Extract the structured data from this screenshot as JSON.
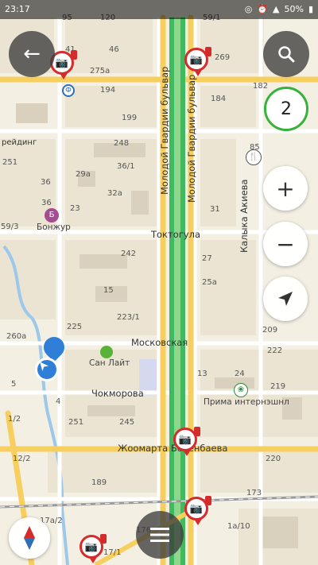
{
  "status_bar": {
    "time": "23:17",
    "battery": "50%",
    "icons": [
      "whatsapp-icon",
      "alarm-icon",
      "signal-icon",
      "battery-icon"
    ]
  },
  "map": {
    "streets": {
      "toktogula": "Токтогула",
      "moskovskaya": "Московская",
      "chokmorova": "Чокморова",
      "zhoomarta": "Жоомарта Бокенбаева",
      "molodoy_gvardii_1": "Молодой Гвардии бульвар",
      "molodoy_gvardii_2": "Молодой Гвардии бульвар",
      "kalyka_akieva": "Калыка Акиева",
      "reiding": "рейдинг"
    },
    "pois": {
      "bonjour": "Бонжур",
      "san_lait": "Сан Лайт",
      "prima": "Прима интернэшнл"
    },
    "house_numbers": [
      {
        "id": "h95",
        "t": "95"
      },
      {
        "id": "h120",
        "t": "120"
      },
      {
        "id": "h59_1",
        "t": "59/1"
      },
      {
        "id": "h41",
        "t": "41"
      },
      {
        "id": "h46",
        "t": "46"
      },
      {
        "id": "h269",
        "t": "269"
      },
      {
        "id": "h275a",
        "t": "275а"
      },
      {
        "id": "h194",
        "t": "194"
      },
      {
        "id": "h182",
        "t": "182"
      },
      {
        "id": "h184",
        "t": "184"
      },
      {
        "id": "h199",
        "t": "199"
      },
      {
        "id": "h248",
        "t": "248"
      },
      {
        "id": "h85",
        "t": "85"
      },
      {
        "id": "h251a",
        "t": "251"
      },
      {
        "id": "h29a",
        "t": "29а"
      },
      {
        "id": "h36_1",
        "t": "36/1"
      },
      {
        "id": "h36",
        "t": "36"
      },
      {
        "id": "h32a",
        "t": "32а"
      },
      {
        "id": "h23",
        "t": "23"
      },
      {
        "id": "h31",
        "t": "31"
      },
      {
        "id": "h59_3",
        "t": "59/3"
      },
      {
        "id": "h242",
        "t": "242"
      },
      {
        "id": "h27",
        "t": "27"
      },
      {
        "id": "h25a",
        "t": "25а"
      },
      {
        "id": "h15",
        "t": "15"
      },
      {
        "id": "h223_1",
        "t": "223/1"
      },
      {
        "id": "h225",
        "t": "225"
      },
      {
        "id": "h209",
        "t": "209"
      },
      {
        "id": "h260a",
        "t": "260а"
      },
      {
        "id": "h222",
        "t": "222"
      },
      {
        "id": "h13",
        "t": "13"
      },
      {
        "id": "h24",
        "t": "24"
      },
      {
        "id": "h219",
        "t": "219"
      },
      {
        "id": "h5",
        "t": "5"
      },
      {
        "id": "h4",
        "t": "4"
      },
      {
        "id": "h1_2",
        "t": "1/2"
      },
      {
        "id": "h251b",
        "t": "251"
      },
      {
        "id": "h245",
        "t": "245"
      },
      {
        "id": "h220",
        "t": "220"
      },
      {
        "id": "h12_2",
        "t": "12/2"
      },
      {
        "id": "h189",
        "t": "189"
      },
      {
        "id": "h17a_2",
        "t": "17а/2"
      },
      {
        "id": "h17_1",
        "t": "17/1"
      },
      {
        "id": "h176",
        "t": "176"
      },
      {
        "id": "h1a_10",
        "t": "1а/10"
      },
      {
        "id": "h173",
        "t": "173"
      },
      {
        "id": "h36b",
        "t": "36"
      }
    ]
  },
  "controls": {
    "back_label": "←",
    "search_label": "search",
    "zoom_in_label": "+",
    "zoom_out_label": "−",
    "layers_count": "2"
  },
  "colors": {
    "map_bg": "#f3efe3",
    "block": "#ebe4d2",
    "road": "#ffffff",
    "main_road": "#f6cf5e",
    "boulevard_green": "#3dbb5e",
    "water": "#9cc8e9",
    "camera_red": "#d62b2b",
    "location_blue": "#2f7fd8",
    "badge_green": "#36b33b"
  }
}
